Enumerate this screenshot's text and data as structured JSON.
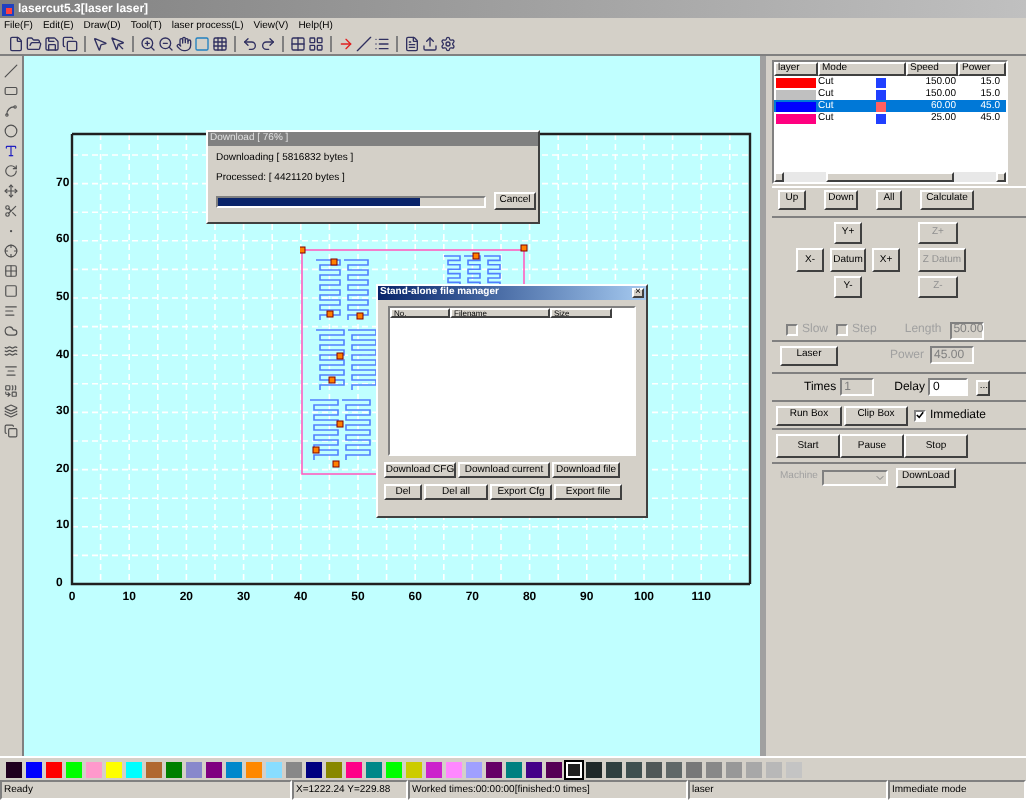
{
  "window": {
    "title": "lasercut5.3[laser laser]"
  },
  "menu": [
    "File(F)",
    "Edit(E)",
    "Draw(D)",
    "Tool(T)",
    "laser process(L)",
    "View(V)",
    "Help(H)"
  ],
  "canvas": {
    "xticks": [
      "0",
      "10",
      "20",
      "30",
      "40",
      "50",
      "60",
      "70",
      "80",
      "90",
      "100",
      "110"
    ],
    "yticks": [
      "70",
      "60",
      "50",
      "40",
      "30",
      "20",
      "10",
      "0"
    ]
  },
  "layers": {
    "columns": [
      "layer",
      "Mode",
      "Speed",
      "Power"
    ],
    "rows": [
      {
        "color": "#ff0000",
        "mode": "Cut",
        "speed": "150.00",
        "power": "15.0",
        "selected": false
      },
      {
        "color": "#c0c0c0",
        "mode": "Cut",
        "speed": "150.00",
        "power": "15.0",
        "selected": false
      },
      {
        "color": "#0000ff",
        "mode": "Cut",
        "speed": "60.00",
        "power": "45.0",
        "selected": true
      },
      {
        "color": "#ff0080",
        "mode": "Cut",
        "speed": "25.00",
        "power": "45.0",
        "selected": false
      }
    ]
  },
  "layer_buttons": [
    "Up",
    "Down",
    "All",
    "Calculate"
  ],
  "jog": {
    "y_plus": {
      "label": "Y+",
      "disabled": false
    },
    "x_minus": {
      "label": "X-",
      "disabled": false
    },
    "datum": {
      "label": "Datum",
      "disabled": false
    },
    "x_plus": {
      "label": "X+",
      "disabled": false
    },
    "y_minus": {
      "label": "Y-",
      "disabled": false
    },
    "z_plus": {
      "label": "Z+",
      "disabled": true
    },
    "z_datum": {
      "label": "Z Datum",
      "disabled": true
    },
    "z_minus": {
      "label": "Z-",
      "disabled": true
    }
  },
  "slow": {
    "label": "Slow",
    "checked": false,
    "disabled": true
  },
  "step": {
    "label": "Step",
    "checked": false,
    "disabled": true
  },
  "length": {
    "label": "Length",
    "value": "50.00",
    "disabled": true
  },
  "laser_button": "Laser",
  "power": {
    "label": "Power",
    "value": "45.00",
    "disabled": true
  },
  "times": {
    "label": "Times",
    "value": "1",
    "disabled": true
  },
  "delay": {
    "label": "Delay",
    "value": "0",
    "disabled": false
  },
  "delay_more": "...",
  "run_box": "Run Box",
  "clip_box": "Clip Box",
  "immediate": {
    "label": "Immediate",
    "checked": true,
    "disabled": false
  },
  "run_buttons": [
    "Start",
    "Pause",
    "Stop"
  ],
  "machine": {
    "label": "Machine",
    "disabled": true
  },
  "download_button": "DownLoad",
  "download_dialog": {
    "title": "Download [ 76% ]",
    "downloading": "Downloading [ 5816832 bytes ]",
    "processed": "Processed: [ 4421120 bytes ]",
    "level": 0.76,
    "cancel": "Cancel"
  },
  "file_manager": {
    "title": "Stand-alone file manager",
    "close": "×",
    "columns": [
      "No.",
      "Filename",
      "Size"
    ],
    "buttons": [
      [
        "Download CFG",
        "Download current",
        "Download file"
      ],
      [
        "Del",
        "Del all",
        "Export Cfg",
        "Export file"
      ]
    ]
  },
  "palette": [
    {
      "color": "#200020",
      "selected": false
    },
    {
      "color": "#0000ff",
      "selected": false
    },
    {
      "color": "#ff0000",
      "selected": false
    },
    {
      "color": "#00ff00",
      "selected": false
    },
    {
      "color": "#ff99cc",
      "selected": false
    },
    {
      "color": "#ffff00",
      "selected": false
    },
    {
      "color": "#00ffff",
      "selected": false
    },
    {
      "color": "#b06830",
      "selected": false
    },
    {
      "color": "#008000",
      "selected": false
    },
    {
      "color": "#8888cc",
      "selected": false
    },
    {
      "color": "#800080",
      "selected": false
    },
    {
      "color": "#0088cc",
      "selected": false
    },
    {
      "color": "#ff8800",
      "selected": false
    },
    {
      "color": "#88ddff",
      "selected": false
    },
    {
      "color": "#888888",
      "selected": false
    },
    {
      "color": "#000080",
      "selected": false
    },
    {
      "color": "#888800",
      "selected": false
    },
    {
      "color": "#ff0088",
      "selected": false
    },
    {
      "color": "#008888",
      "selected": false
    },
    {
      "color": "#00ff00",
      "selected": false
    },
    {
      "color": "#cccc00",
      "selected": false
    },
    {
      "color": "#cc22cc",
      "selected": false
    },
    {
      "color": "#ff88ff",
      "selected": false
    },
    {
      "color": "#a0a0ff",
      "selected": false
    },
    {
      "color": "#660066",
      "selected": false
    },
    {
      "color": "#008080",
      "selected": false
    },
    {
      "color": "#440088",
      "selected": false
    },
    {
      "color": "#550055",
      "selected": false
    },
    {
      "color": "#202020",
      "selected": true
    },
    {
      "color": "#202828",
      "selected": false
    },
    {
      "color": "#304040",
      "selected": false
    },
    {
      "color": "#405050",
      "selected": false
    },
    {
      "color": "#505858",
      "selected": false
    },
    {
      "color": "#606868",
      "selected": false
    },
    {
      "color": "#787878",
      "selected": false
    },
    {
      "color": "#888888",
      "selected": false
    },
    {
      "color": "#989898",
      "selected": false
    },
    {
      "color": "#a8a8a8",
      "selected": false
    },
    {
      "color": "#b8b8b8",
      "selected": false
    },
    {
      "color": "#c4c4c4",
      "selected": false
    }
  ],
  "status_bar": [
    "Ready",
    "X=1222.24 Y=229.88",
    "Worked times:00:00:00[finished:0 times]",
    "laser",
    "Immediate mode"
  ]
}
